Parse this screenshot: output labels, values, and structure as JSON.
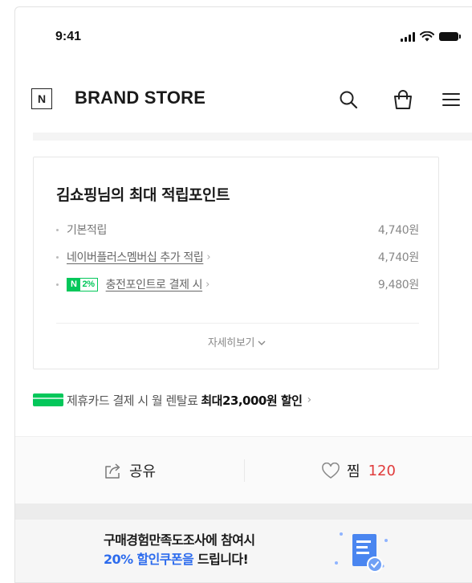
{
  "status_bar": {
    "time": "9:41"
  },
  "header": {
    "logo_letter": "N",
    "title": "BRAND STORE"
  },
  "points": {
    "title": "김쇼핑님의 최대 적립포인트",
    "rows": [
      {
        "label": "기본적립",
        "value": "4,740원"
      },
      {
        "label": "네이버플러스멤버십 추가 적립",
        "value": "4,740원"
      },
      {
        "badge_n": "N",
        "badge_pct": "2%",
        "label": "충전포인트로 결제 시",
        "value": "9,480원"
      }
    ],
    "more_label": "자세히보기"
  },
  "card_promo": {
    "text": "제휴카드 결제 시 월 렌탈료",
    "highlight": "최대23,000원 할인"
  },
  "actions": {
    "share_label": "공유",
    "zzim_label": "찜",
    "zzim_count": "120"
  },
  "survey": {
    "line1": "구매경험만족도조사에 참여시",
    "line2_blue": "20% 할인쿠폰을",
    "line2_rest": " 드립니다!"
  },
  "colors": {
    "naver_green": "#03c75a",
    "accent_blue": "#2c6bed",
    "count_red": "#e03b3b"
  }
}
